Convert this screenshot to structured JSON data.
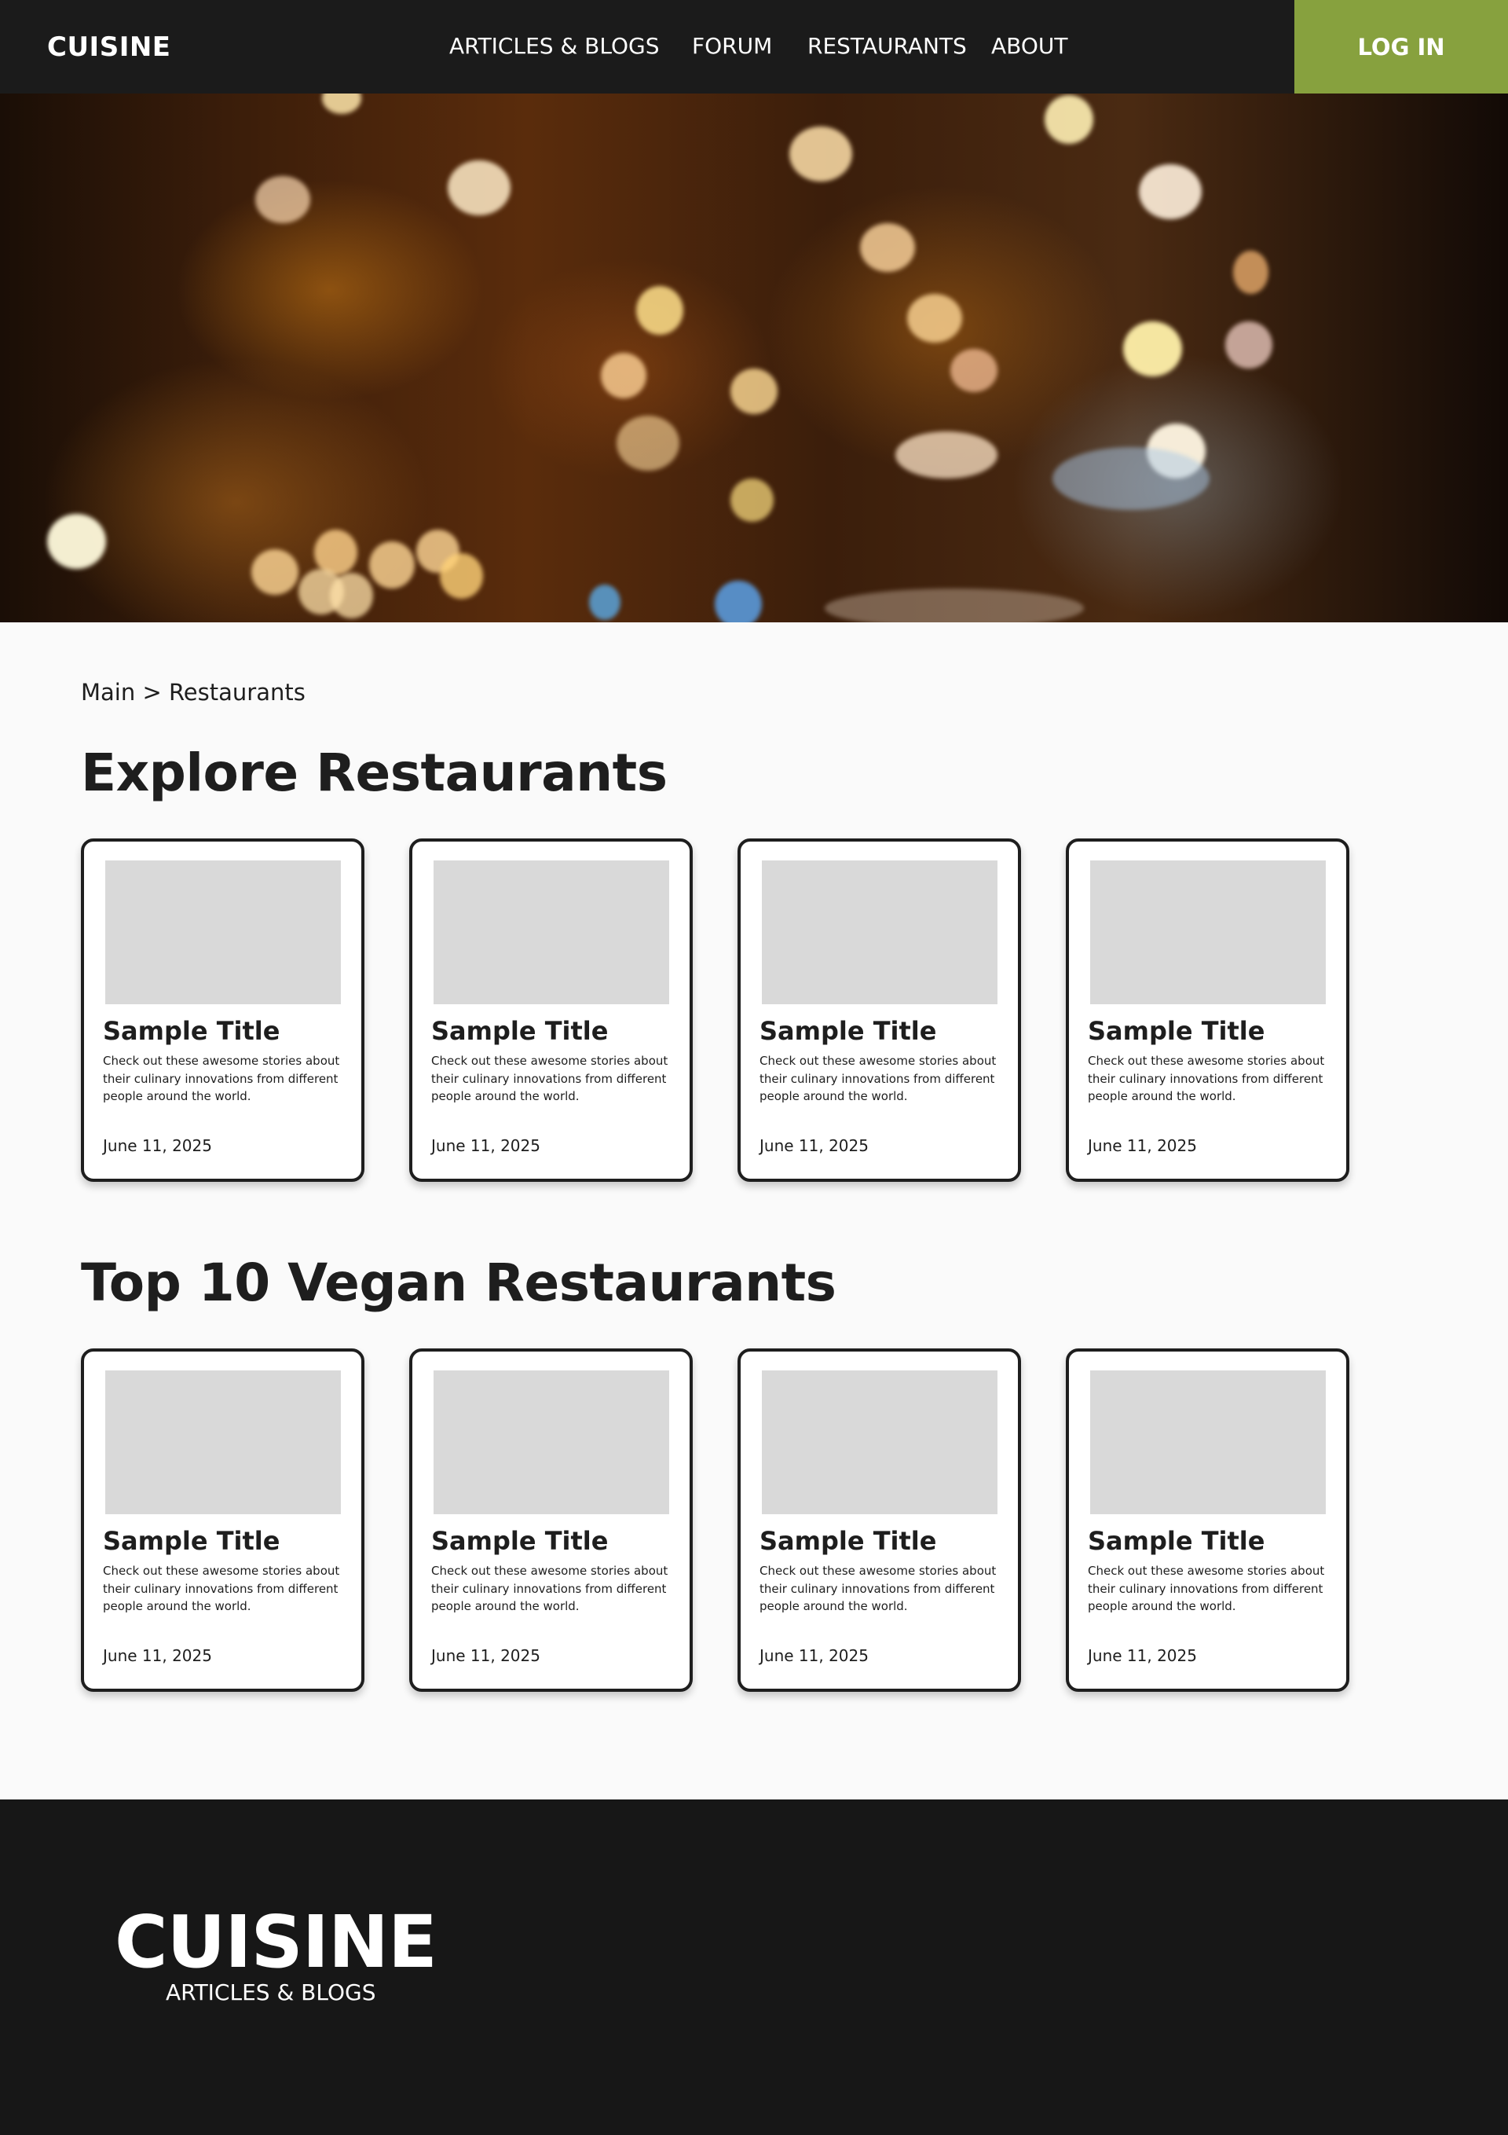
{
  "navbar": {
    "logo": "CUISINE",
    "links": [
      "ARTICLES & BLOGS",
      "FORUM",
      "RESTAURANTS",
      "ABOUT"
    ],
    "login_label": "LOG IN",
    "login_color": "#87a13e"
  },
  "breadcrumb": "Main > Restaurants",
  "sections": [
    {
      "title": "Explore Restaurants",
      "cards": [
        {
          "title": "Sample Title",
          "description": "Check out these awesome stories about their culinary innovations from different people around the world.",
          "date": "June 11, 2025"
        },
        {
          "title": "Sample Title",
          "description": "Check out these awesome stories about their culinary innovations from different people around the world.",
          "date": "June 11, 2025"
        },
        {
          "title": "Sample Title",
          "description": "Check out these awesome stories about their culinary innovations from different people around the world.",
          "date": "June 11, 2025"
        },
        {
          "title": "Sample Title",
          "description": "Check out these awesome stories about their culinary innovations from different people around the world.",
          "date": "June 11, 2025"
        }
      ]
    },
    {
      "title": "Top 10 Vegan Restaurants",
      "cards": [
        {
          "title": "Sample Title",
          "description": "Check out these awesome stories about their culinary innovations from different people around the world.",
          "date": "June 11, 2025"
        },
        {
          "title": "Sample Title",
          "description": "Check out these awesome stories about their culinary innovations from different people around the world.",
          "date": "June 11, 2025"
        },
        {
          "title": "Sample Title",
          "description": "Check out these awesome stories about their culinary innovations from different people around the world.",
          "date": "June 11, 2025"
        },
        {
          "title": "Sample Title",
          "description": "Check out these awesome stories about their culinary innovations from different people around the world.",
          "date": "June 11, 2025"
        }
      ]
    }
  ],
  "footer": {
    "logo": "CUISINE",
    "subtitle": "ARTICLES & BLOGS"
  }
}
